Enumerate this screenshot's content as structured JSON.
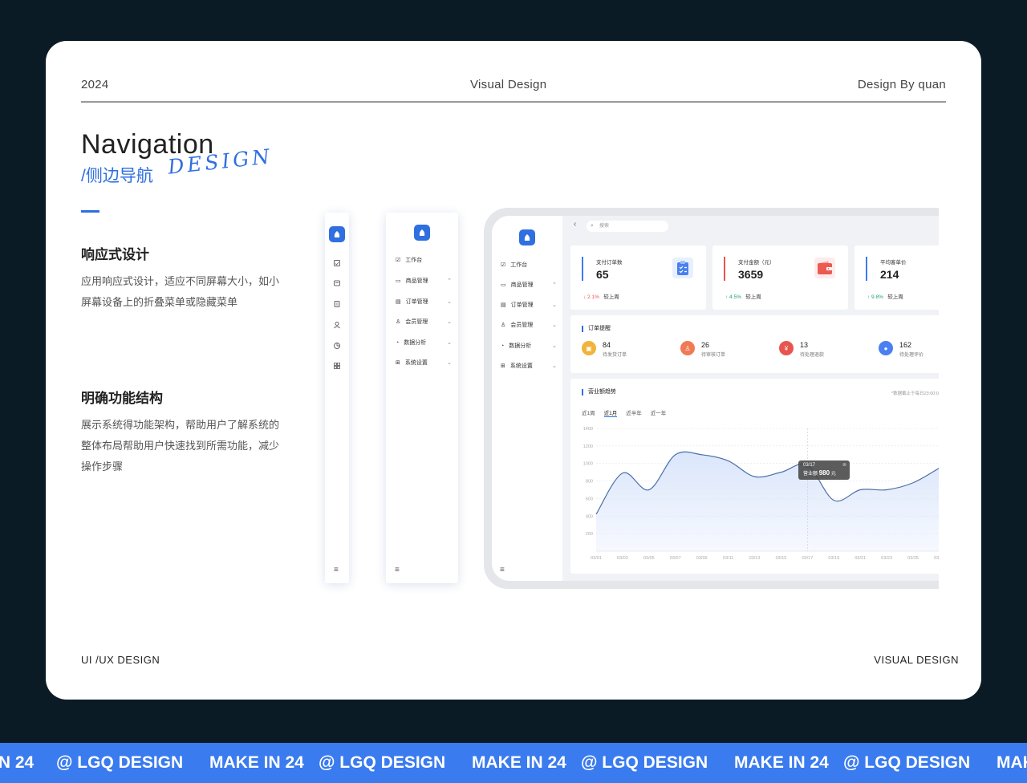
{
  "header": {
    "year": "2024",
    "center": "Visual Design",
    "right": "Design By quan"
  },
  "hero": {
    "title": "Navigation",
    "subtitle": "/侧边导航",
    "script": "DESIGN"
  },
  "sections": [
    {
      "title": "响应式设计",
      "lines": [
        "应用响应式设计，适应不同屏幕大小，如小",
        "屏幕设备上的折叠菜单或隐藏菜单"
      ]
    },
    {
      "title": "明确功能结构",
      "lines": [
        "展示系统得功能架构，帮助用户了解系统的",
        "整体布局帮助用户快速找到所需功能，减少",
        "操作步骤"
      ]
    }
  ],
  "footer": {
    "left": "UI /UX DESIGN",
    "right": "VISUAL  DESIGN"
  },
  "menu": {
    "items": [
      {
        "label": "工作台",
        "icon": "workbench-icon",
        "chevron": ""
      },
      {
        "label": "商品管理",
        "icon": "product-icon",
        "chevron": "up"
      },
      {
        "label": "订单管理",
        "icon": "order-icon",
        "chevron": "down"
      },
      {
        "label": "会员管理",
        "icon": "member-icon",
        "chevron": "down"
      },
      {
        "label": "数据分析",
        "icon": "analytics-icon",
        "chevron": "down"
      },
      {
        "label": "系统设置",
        "icon": "settings-icon",
        "chevron": "down"
      }
    ],
    "collapse_icon": "≡"
  },
  "dashboard": {
    "search_placeholder": "搜索",
    "back_icon": "‹",
    "stats": [
      {
        "label": "支付订单数",
        "value": "65",
        "trend": "↓ 2.1%",
        "compare": "较上周",
        "accent": "#3a7bef",
        "trend_color": "#e8554e",
        "icon": "clipboard-check-icon",
        "icon_bg": "#e8f0fd"
      },
      {
        "label": "支付金额（元）",
        "value": "3659",
        "trend": "↑ 4.5%",
        "compare": "较上周",
        "accent": "#e8554e",
        "trend_color": "#21a06a",
        "icon": "wallet-icon",
        "icon_bg": "#fdeceb"
      },
      {
        "label": "平均客单价",
        "value": "214",
        "trend": "↑ 9.8%",
        "compare": "较上周",
        "accent": "#3a7bef",
        "trend_color": "#21a06a",
        "icon": "",
        "icon_bg": ""
      }
    ],
    "reminders": {
      "title": "订单提醒",
      "items": [
        {
          "value": "84",
          "label": "待发货订单",
          "color": "#f0b43a",
          "icon": "inbox-icon",
          "glyph": "▣"
        },
        {
          "value": "26",
          "label": "待审核订单",
          "color": "#f07a55",
          "icon": "stamp-icon",
          "glyph": "♙"
        },
        {
          "value": "13",
          "label": "待处理退款",
          "color": "#e8554e",
          "icon": "refund-icon",
          "glyph": "¥"
        },
        {
          "value": "162",
          "label": "待处理评价",
          "color": "#4a80f0",
          "icon": "user-review-icon",
          "glyph": "●"
        }
      ]
    },
    "trend_panel": {
      "title": "营业额趋势",
      "note": "*数据截止于每日23:00:00",
      "tabs": [
        "近1周",
        "近1月",
        "近半年",
        "近一年"
      ],
      "active_tab": 1,
      "tooltip": {
        "date": "03/17",
        "label": "营业额",
        "value": "980",
        "unit": "元"
      }
    }
  },
  "chart_data": {
    "type": "area",
    "title": "营业额趋势",
    "x": [
      "03/01",
      "03/03",
      "03/05",
      "03/07",
      "03/09",
      "03/11",
      "03/13",
      "03/15",
      "03/17",
      "03/19",
      "03/21",
      "03/23",
      "03/25",
      "03/27"
    ],
    "values": [
      420,
      890,
      700,
      1100,
      1100,
      1030,
      850,
      900,
      980,
      580,
      700,
      700,
      780,
      950
    ],
    "ylim": [
      0,
      1400
    ],
    "yticks": [
      200,
      400,
      600,
      800,
      1000,
      1200,
      1400
    ],
    "grid": true,
    "colors": {
      "line": "#4a6fa8",
      "fill": "#dbe6fb"
    }
  },
  "ticker": [
    "IN 24",
    "@ LGQ DESIGN",
    "MAKE IN 24",
    "@ LGQ DESIGN",
    "MAKE IN 24",
    "@ LGQ DESIGN",
    "MAKE IN 24",
    "@ LGQ DESIGN",
    "MAK"
  ]
}
